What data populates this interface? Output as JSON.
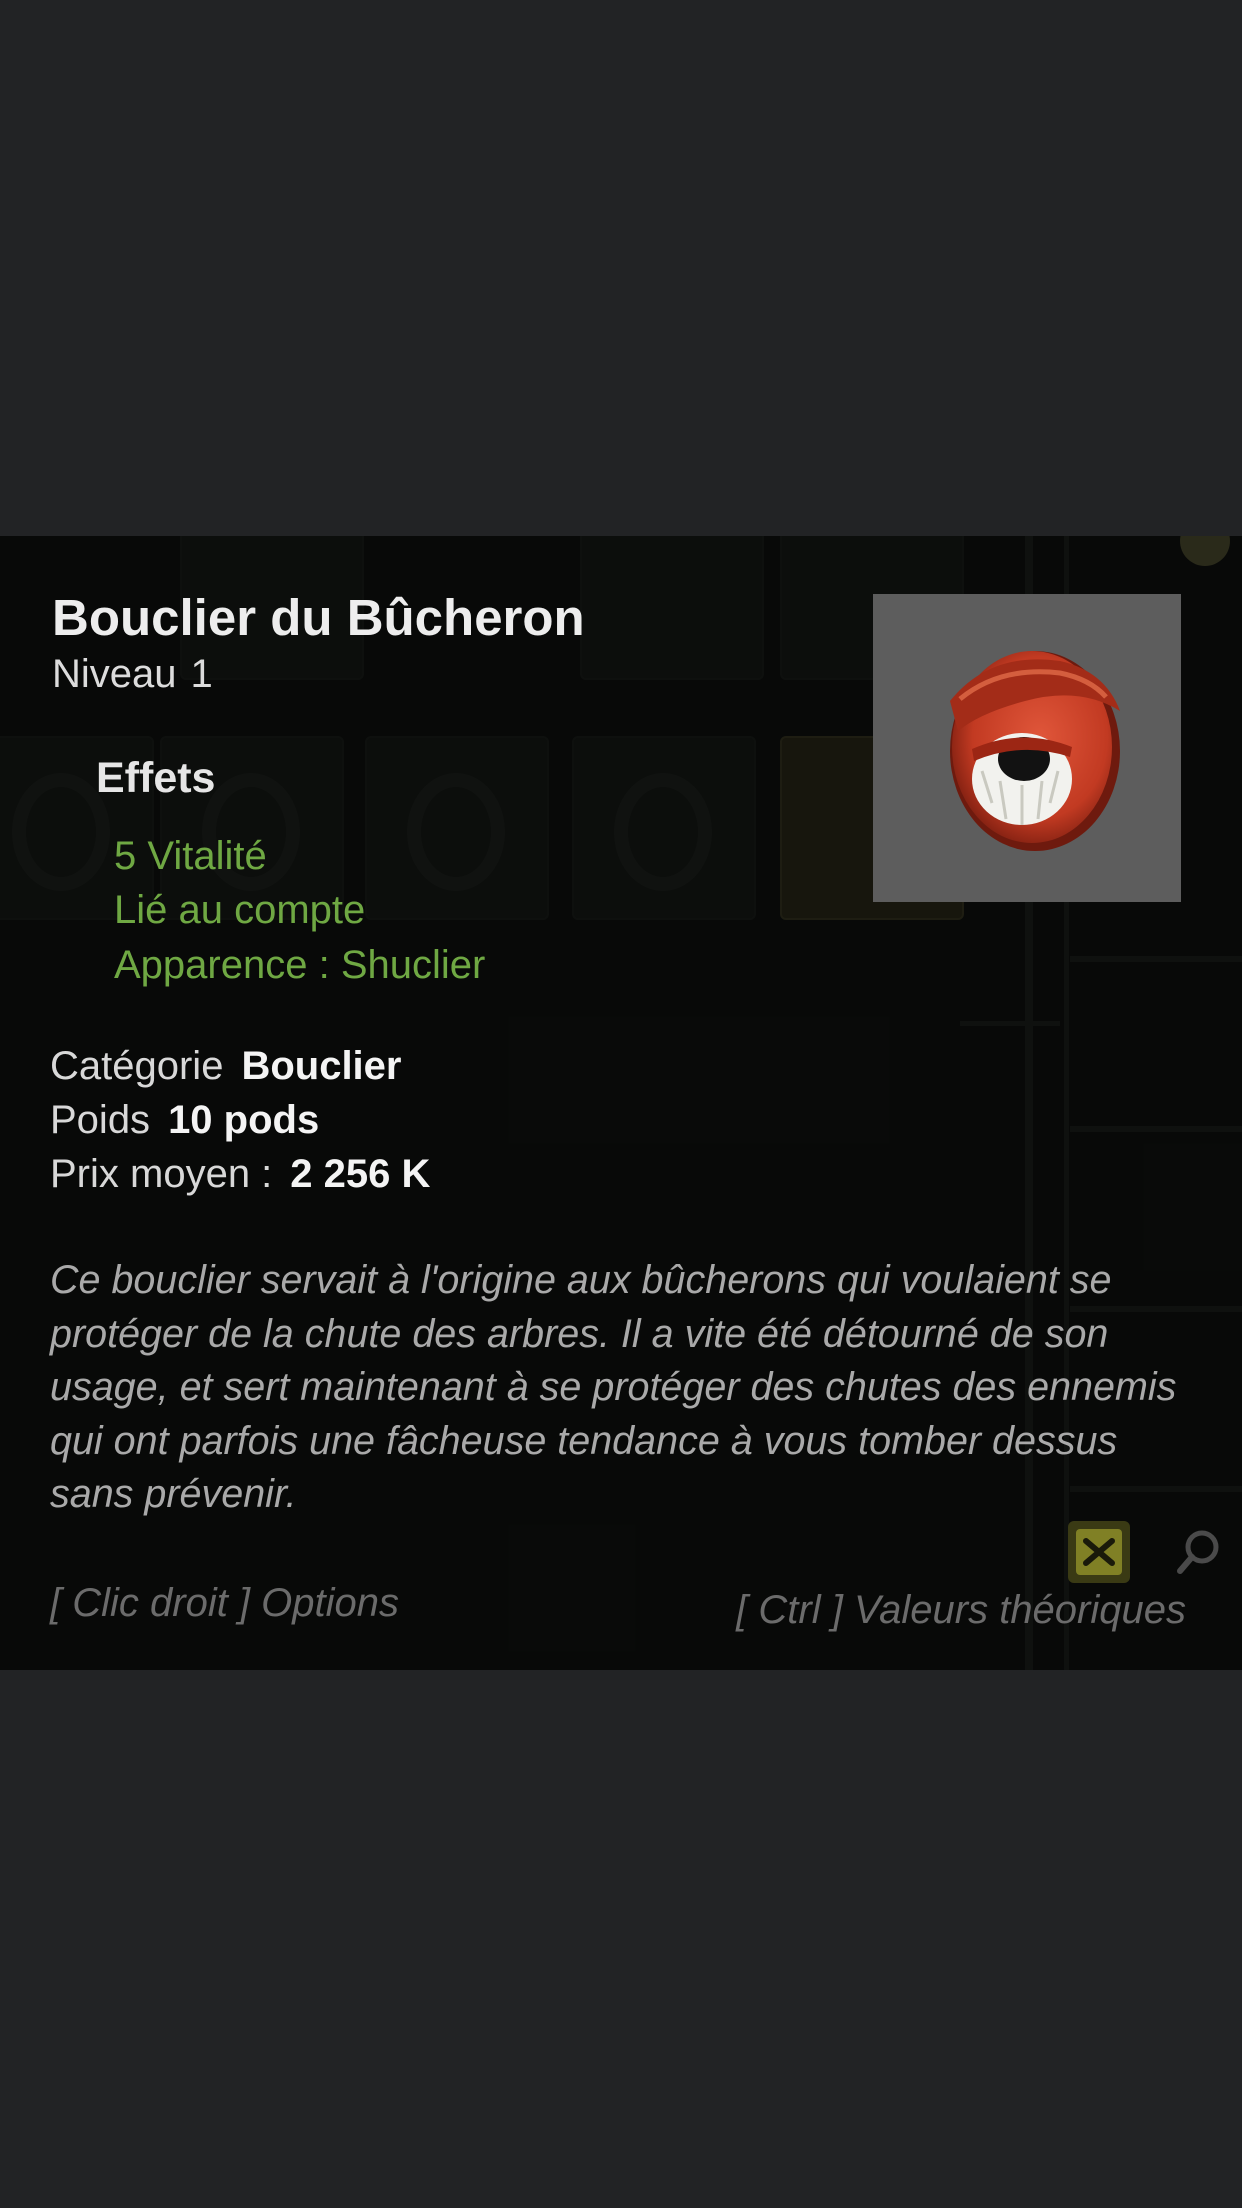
{
  "item": {
    "name": "Bouclier du Bûcheron",
    "level_label": "Niveau",
    "level_value": "1",
    "image_icon": "shield-icon"
  },
  "effects": {
    "title": "Effets",
    "lines": [
      "5 Vitalité",
      "Lié au compte",
      "Apparence : Shuclier"
    ],
    "color": "#6fa843"
  },
  "info": {
    "category_label": "Catégorie",
    "category_value": "Bouclier",
    "weight_label": "Poids",
    "weight_value": "10 pods",
    "price_label": "Prix moyen :",
    "price_value": "2 256 K"
  },
  "description": "Ce bouclier servait à l'origine aux bûcherons qui voulaient se protéger de la chute des arbres. Il a vite été détourné de son usage, et sert maintenant à se protéger des chutes des ennemis qui ont parfois une fâcheuse tendance à vous tomber dessus sans prévenir.",
  "hints": {
    "left": "[ Clic droit ] Options",
    "right": "[ Ctrl ] Valeurs théoriques"
  },
  "colors": {
    "background": "#222325",
    "tooltip": "#0a0b0a",
    "shield_red": "#c23a22"
  }
}
